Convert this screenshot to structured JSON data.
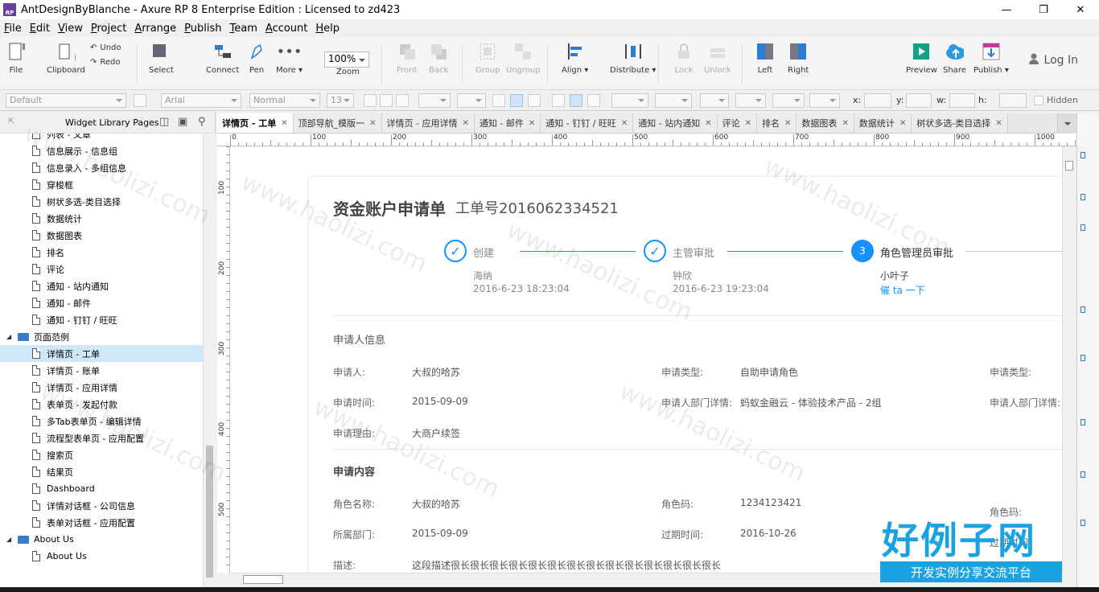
{
  "window": {
    "title": "AntDesignByBlanche - Axure RP 8 Enterprise Edition : Licensed to zd423",
    "app_icon": "RP"
  },
  "menu": [
    {
      "pre": "",
      "key": "F",
      "post": "ile"
    },
    {
      "pre": "",
      "key": "E",
      "post": "dit"
    },
    {
      "pre": "",
      "key": "V",
      "post": "iew"
    },
    {
      "pre": "",
      "key": "P",
      "post": "roject"
    },
    {
      "pre": "",
      "key": "A",
      "post": "rrange"
    },
    {
      "pre": "",
      "key": "P",
      "post": "ublish"
    },
    {
      "pre": "",
      "key": "T",
      "post": "eam"
    },
    {
      "pre": "",
      "key": "A",
      "post": "ccount"
    },
    {
      "pre": "",
      "key": "H",
      "post": "elp"
    }
  ],
  "toolbar": {
    "file": "File",
    "clipboard": "Clipboard",
    "undo": "Undo",
    "redo": "Redo",
    "select": "Select",
    "connect": "Connect",
    "pen": "Pen",
    "more": "More ▾",
    "zoom_value": "100%",
    "zoom": "Zoom",
    "front": "Front",
    "back": "Back",
    "group": "Group",
    "ungroup": "Ungroup",
    "align": "Align ▾",
    "distribute": "Distribute ▾",
    "lock": "Lock",
    "unlock": "Unlock",
    "left": "Left",
    "right": "Right",
    "preview": "Preview",
    "share": "Share",
    "publish": "Publish ▾",
    "login": "Log In"
  },
  "formatbar": {
    "style": "Default",
    "font": "Arial",
    "weight": "Normal",
    "size": "13",
    "x": "x:",
    "y": "y:",
    "w": "w:",
    "h": "h:",
    "hidden": "Hidden"
  },
  "panel": {
    "title": "Widget Library Pages",
    "items": [
      {
        "label": "列表 - 文章",
        "level": 2
      },
      {
        "label": "信息展示 - 信息组",
        "level": 2
      },
      {
        "label": "信息录入 - 多组信息",
        "level": 2
      },
      {
        "label": "穿梭框",
        "level": 2
      },
      {
        "label": "树状多选-类目选择",
        "level": 2
      },
      {
        "label": "数据统计",
        "level": 2
      },
      {
        "label": "数据图表",
        "level": 2
      },
      {
        "label": "排名",
        "level": 2
      },
      {
        "label": "评论",
        "level": 2
      },
      {
        "label": "通知 - 站内通知",
        "level": 2
      },
      {
        "label": "通知 - 邮件",
        "level": 2
      },
      {
        "label": "通知 - 钉钉 / 旺旺",
        "level": 2
      },
      {
        "label": "页面范例",
        "level": 1,
        "folder": true
      },
      {
        "label": "详情页 - 工单",
        "level": 2,
        "selected": true
      },
      {
        "label": "详情页 - 账单",
        "level": 2
      },
      {
        "label": "详情页 - 应用详情",
        "level": 2
      },
      {
        "label": "表单页 - 发起付款",
        "level": 2
      },
      {
        "label": "多Tab表单页 - 编辑详情",
        "level": 2
      },
      {
        "label": "流程型表单页 - 应用配置",
        "level": 2
      },
      {
        "label": "搜索页",
        "level": 2
      },
      {
        "label": "结果页",
        "level": 2
      },
      {
        "label": "Dashboard",
        "level": 2
      },
      {
        "label": "详情对话框 - 公司信息",
        "level": 2
      },
      {
        "label": "表单对话框 - 应用配置",
        "level": 2
      },
      {
        "label": "About Us",
        "level": 1,
        "folder": true
      },
      {
        "label": "About Us",
        "level": 2
      }
    ]
  },
  "tabs": [
    {
      "label": "详情页 - 工单",
      "active": true
    },
    {
      "label": "顶部导航_模版一"
    },
    {
      "label": "详情页 - 应用详情"
    },
    {
      "label": "通知 - 邮件"
    },
    {
      "label": "通知 - 钉钉 / 旺旺"
    },
    {
      "label": "通知 - 站内通知"
    },
    {
      "label": "评论"
    },
    {
      "label": "排名"
    },
    {
      "label": "数据图表"
    },
    {
      "label": "数据统计"
    },
    {
      "label": "树状多选-类目选择"
    }
  ],
  "ruler": {
    "h": [
      "0",
      "100",
      "200",
      "300",
      "400",
      "500",
      "600",
      "700",
      "800",
      "900",
      "1000"
    ],
    "v": [
      "100",
      "200",
      "300",
      "400",
      "500"
    ]
  },
  "doc": {
    "title": "资金账户申请单",
    "ticket": "工单号2016062334521",
    "steps": [
      {
        "label": "创建",
        "person": "海纳",
        "time": "2016-6-23 18:23:04",
        "icon": "✓"
      },
      {
        "label": "主管审批",
        "person": "钟欣",
        "time": "2016-6-23  19:23:04",
        "icon": "✓"
      },
      {
        "label": "角色管理员审批",
        "person": "小叶子",
        "link": "催 ta 一下",
        "icon": "3"
      }
    ],
    "section1": "申请人信息",
    "s1": {
      "applicant_l": "申请人:",
      "applicant_v": "大叔的哈苏",
      "type_l": "申请类型:",
      "type_v": "自助申请角色",
      "type_l2": "申请类型:",
      "time_l": "申请时间:",
      "time_v": "2015-09-09",
      "dept_l": "申请人部门详情:",
      "dept_v": "蚂蚁金融云 - 体验技术产品 - 2组",
      "dept_l2": "申请人部门详情:",
      "reason_l": "申请理由:",
      "reason_v": "大商户续签"
    },
    "section2": "申请内容",
    "s2": {
      "role_l": "角色名称:",
      "role_v": "大叔的哈苏",
      "code_l": "角色码:",
      "code_v": "1234123421",
      "code_l2": "角色码:",
      "dept_l": "所属部门:",
      "dept_v": "2015-09-09",
      "exp_l": "过期时间:",
      "exp_v": "2016-10-26",
      "exp_l2": "过期时间:",
      "desc_l": "描述:",
      "desc_v": "这段描述很长很长很长很长很长很长很长很长很长很长很长很长很长很长"
    }
  },
  "watermark": "www.haolizi.com",
  "logo": {
    "big": "好例子网",
    "small": "开发实例分享交流平台"
  },
  "colors": {
    "accent": "#1890ff",
    "folder": "#3a7bc8",
    "logo": "#1aa3e0"
  }
}
